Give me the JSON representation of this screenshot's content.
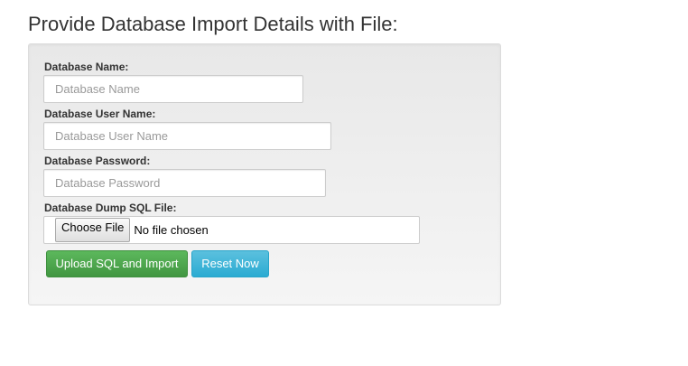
{
  "page": {
    "title": "Provide Database Import Details with File:"
  },
  "form": {
    "db_name": {
      "label": "Database Name:",
      "placeholder": "Database Name",
      "value": ""
    },
    "db_user": {
      "label": "Database User Name:",
      "placeholder": "Database User Name",
      "value": ""
    },
    "db_password": {
      "label": "Database Password:",
      "placeholder": "Database Password",
      "value": ""
    },
    "dump_file": {
      "label": "Database Dump SQL File:",
      "choose_label": "Choose File",
      "status": "No file chosen"
    },
    "upload_label": "Upload SQL and Import",
    "reset_label": "Reset Now"
  },
  "colors": {
    "success": "#5cb85c",
    "info": "#5bc0de",
    "well_background": "#f5f5f5"
  }
}
